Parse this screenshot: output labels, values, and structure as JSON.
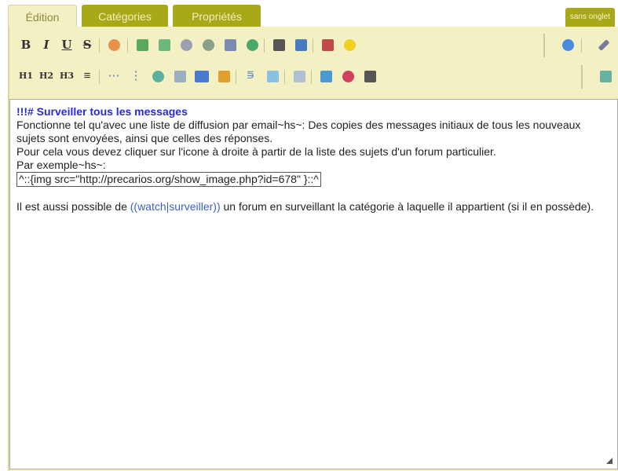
{
  "tabs": {
    "edition": "Édition",
    "categories": "Catégories",
    "proprietes": "Propriétés",
    "sans_onglet": "sans onglet"
  },
  "toolbar1": {
    "bold": "B",
    "italic": "I",
    "underline": "U",
    "strike": "S"
  },
  "toolbar2": {
    "h1": "H1",
    "h2": "H2",
    "h3": "H3"
  },
  "content": {
    "heading": "!!!# Surveiller tous les messages",
    "line1": "Fonctionne tel qu'avec une liste de diffusion par email~hs~: Des copies des messages initiaux de tous les nouveaux sujets sont envoyées, ainsi que celles des réponses.",
    "line2": "Pour cela vous devez cliquer sur l'icone à droite à partir de la liste des sujets d'un forum particulier.",
    "line3": "Par exemple~hs~:",
    "code": "^::{img src=\"http://precarios.org/show_image.php?id=678\" }::^",
    "para2_before": "Il est aussi possible de ",
    "para2_link": "((watch|surveiller))",
    "para2_after": " un forum en surveillant la catégorie à laquelle il appartient (si il en possède)."
  },
  "colors": {
    "tab_inactive": "#a8a818",
    "toolbar_bg": "#f3f0c4",
    "heading": "#2a2ad8",
    "link": "#3a5fcd"
  }
}
